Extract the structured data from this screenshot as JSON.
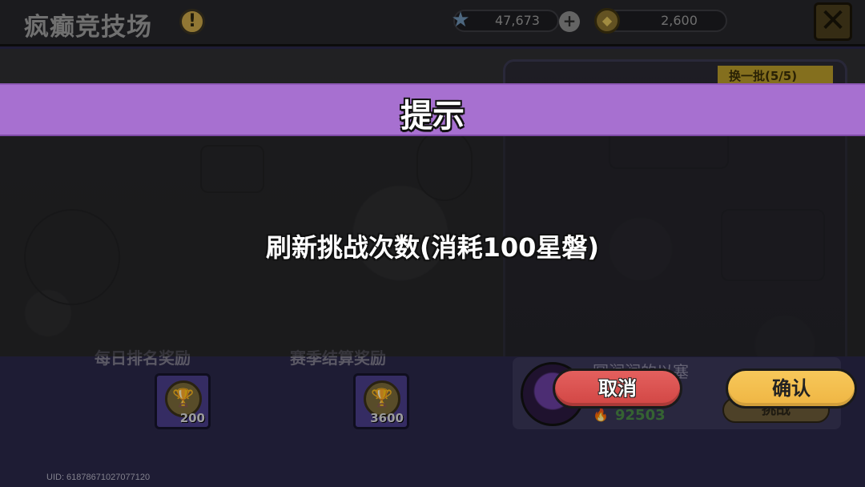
{
  "header": {
    "title": "疯癫竞技场",
    "info_icon": "exclamation-icon",
    "stars_value": "47,673",
    "coins_value": "2,600",
    "close_icon": "close-x-icon"
  },
  "rewards": {
    "daily_rank_label": "每日排名奖励",
    "season_rank_label": "赛季结算奖励",
    "daily_reward_qty": "200",
    "season_reward_qty": "3600"
  },
  "opponent": {
    "name": "圆润润的以塞",
    "score": "92503",
    "challenge_label": "挑战"
  },
  "refresh": {
    "label": "换一批(5/5)"
  },
  "uid": "UID: 61878671027077120",
  "dialog": {
    "title": "提示",
    "message": "刷新挑战次数(消耗100星磐)",
    "cancel_label": "取消",
    "confirm_label": "确认",
    "header_color": "#a770d0",
    "cancel_color": "#d14644",
    "confirm_color": "#efb543"
  }
}
